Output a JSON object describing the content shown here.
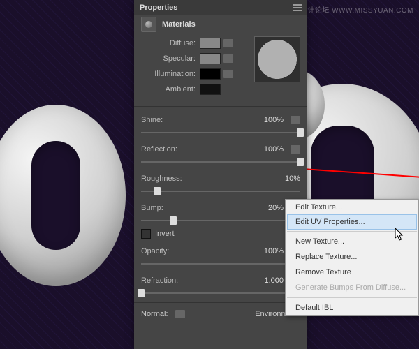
{
  "watermark": "思缘设计论坛  WWW.MISSYUAN.COM",
  "panel": {
    "title": "Properties",
    "section": "Materials",
    "colors": {
      "diffuse": {
        "label": "Diffuse:",
        "hex": "#888888"
      },
      "specular": {
        "label": "Specular:",
        "hex": "#888888"
      },
      "illumination": {
        "label": "Illumination:",
        "hex": "#000000"
      },
      "ambient": {
        "label": "Ambient:",
        "hex": "#111111"
      }
    },
    "sliders": {
      "shine": {
        "label": "Shine:",
        "value": "100%",
        "pos": 100
      },
      "reflection": {
        "label": "Reflection:",
        "value": "100%",
        "pos": 100
      },
      "roughness": {
        "label": "Roughness:",
        "value": "10%",
        "pos": 10
      },
      "bump": {
        "label": "Bump:",
        "value": "20%",
        "pos": 20
      },
      "opacity": {
        "label": "Opacity:",
        "value": "100%",
        "pos": 100
      },
      "refraction": {
        "label": "Refraction:",
        "value": "1.000",
        "pos": 0
      }
    },
    "invert": {
      "label": "Invert",
      "checked": false
    },
    "bottom": {
      "normal": "Normal:",
      "environment": "Environment:"
    }
  },
  "context": {
    "editTexture": "Edit Texture...",
    "editUV": "Edit UV Properties...",
    "newTexture": "New Texture...",
    "replaceTexture": "Replace Texture...",
    "removeTexture": "Remove Texture",
    "generateBumps": "Generate Bumps From Diffuse...",
    "defaultIBL": "Default IBL"
  }
}
